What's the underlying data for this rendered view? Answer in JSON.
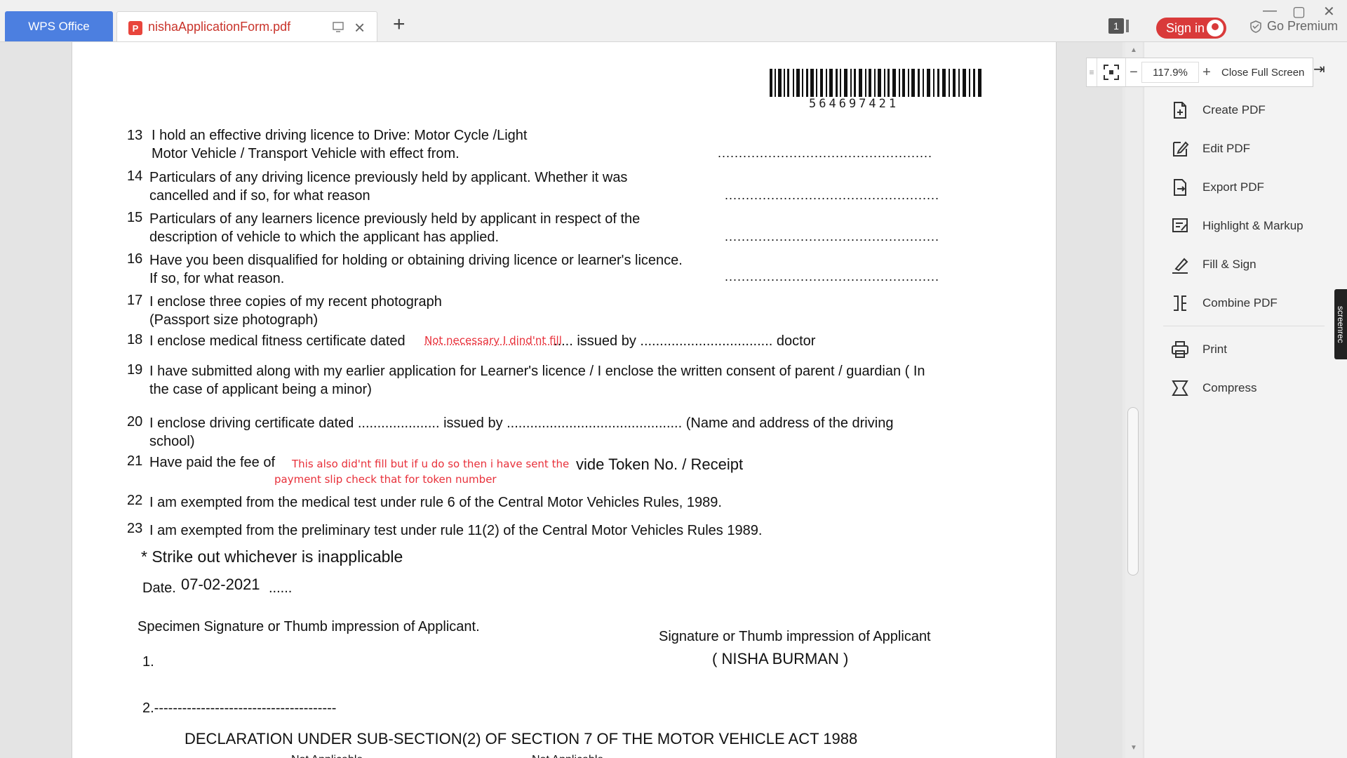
{
  "tabs": {
    "home_label": "WPS Office",
    "doc_label": "nishaApplicationForm.pdf"
  },
  "titlebar": {
    "page_count": "1",
    "signin_label": "Sign in",
    "premium_label": "Go Premium"
  },
  "zoom": {
    "value": "117.9%",
    "close_fullscreen": "Close Full Screen"
  },
  "sidebar": {
    "items": [
      {
        "label": "Create PDF",
        "icon": "create-pdf-icon"
      },
      {
        "label": "Edit PDF",
        "icon": "edit-pdf-icon"
      },
      {
        "label": "Export PDF",
        "icon": "export-pdf-icon"
      },
      {
        "label": "Highlight & Markup",
        "icon": "highlight-icon"
      },
      {
        "label": "Fill & Sign",
        "icon": "fill-sign-icon"
      },
      {
        "label": "Combine PDF",
        "icon": "combine-icon"
      },
      {
        "label": "Print",
        "icon": "print-icon"
      },
      {
        "label": "Compress",
        "icon": "compress-icon"
      }
    ],
    "screenrec_label": "screenrec"
  },
  "document": {
    "barcode_number": "564697421",
    "items": {
      "n13": "13",
      "t13a": "I hold an effective driving licence to Drive: Motor Cycle /Light",
      "t13b": "Motor Vehicle / Transport Vehicle with effect from.",
      "n14": "14",
      "t14a": "Particulars of any driving licence previously held by applicant. Whether it was",
      "t14b": "cancelled and if so, for what reason",
      "n15": "15",
      "t15a": "Particulars of any learners licence previously held by applicant in respect of the",
      "t15b": "description of vehicle to which the applicant has applied.",
      "n16": "16",
      "t16a": "Have you been disqualified for holding or obtaining driving licence or learner's licence.",
      "t16b": "If so, for what reason.",
      "n17": "17",
      "t17a": "I enclose three copies of my recent photograph",
      "t17b": "(Passport size photograph)",
      "n18": "18",
      "t18a": "I enclose medical fitness certificate dated",
      "t18ann": "Not necessary I dind'nt fill",
      "t18b": "..... issued by .................................. doctor",
      "n19": "19",
      "t19a": "I have submitted along with my earlier application for Learner's licence / I enclose the written consent of parent / guardian ( In",
      "t19b": "the case of applicant being a minor)",
      "n20": "20",
      "t20a": "I enclose driving certificate dated ..................... issued by ............................................. (Name and address of the driving",
      "t20b": "school)",
      "n21": "21",
      "t21a": "Have paid the fee of",
      "t21ann1": "This also did'nt fill but if u do so then i have sent the",
      "t21ann2": "payment slip check that for token number",
      "t21b": "vide Token No. / Receipt",
      "n22": "22",
      "t22": "I am exempted from the medical test under rule 6 of the Central Motor Vehicles Rules, 1989.",
      "n23": "23",
      "t23": "I am exempted from the preliminary test under rule 11(2) of the Central Motor Vehicles Rules 1989.",
      "strike": "* Strike out whichever is inapplicable",
      "date_label": "Date.",
      "date_value": "07-02-2021",
      "date_dots": "......",
      "specimen": "Specimen Signature or Thumb impression of Applicant.",
      "sig_applicant": "Signature or Thumb impression of Applicant",
      "sig_name": "( NISHA  BURMAN  )",
      "one": "1.",
      "two": "2.---------------------------------------",
      "declaration": "DECLARATION UNDER SUB-SECTION(2) OF SECTION 7 OF THE MOTOR VEHICLE ACT 1988",
      "na1": "Not Applicable",
      "na2": "Not Applicable"
    },
    "dotlines": {
      "d13": "...................................................",
      "d14": "...................................................",
      "d15": "...................................................",
      "d16": "..................................................."
    }
  }
}
